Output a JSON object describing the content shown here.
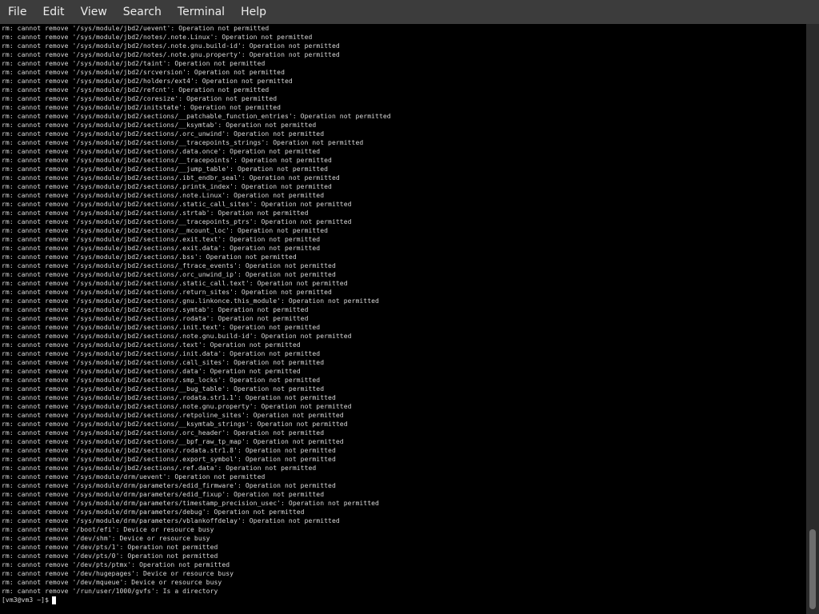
{
  "menubar": {
    "items": [
      "File",
      "Edit",
      "View",
      "Search",
      "Terminal",
      "Help"
    ]
  },
  "terminal": {
    "lines": [
      "rm: cannot remove '/sys/module/jbd2/uevent': Operation not permitted",
      "rm: cannot remove '/sys/module/jbd2/notes/.note.Linux': Operation not permitted",
      "rm: cannot remove '/sys/module/jbd2/notes/.note.gnu.build-id': Operation not permitted",
      "rm: cannot remove '/sys/module/jbd2/notes/.note.gnu.property': Operation not permitted",
      "rm: cannot remove '/sys/module/jbd2/taint': Operation not permitted",
      "rm: cannot remove '/sys/module/jbd2/srcversion': Operation not permitted",
      "rm: cannot remove '/sys/module/jbd2/holders/ext4': Operation not permitted",
      "rm: cannot remove '/sys/module/jbd2/refcnt': Operation not permitted",
      "rm: cannot remove '/sys/module/jbd2/coresize': Operation not permitted",
      "rm: cannot remove '/sys/module/jbd2/initstate': Operation not permitted",
      "rm: cannot remove '/sys/module/jbd2/sections/__patchable_function_entries': Operation not permitted",
      "rm: cannot remove '/sys/module/jbd2/sections/__ksymtab': Operation not permitted",
      "rm: cannot remove '/sys/module/jbd2/sections/.orc_unwind': Operation not permitted",
      "rm: cannot remove '/sys/module/jbd2/sections/__tracepoints_strings': Operation not permitted",
      "rm: cannot remove '/sys/module/jbd2/sections/.data.once': Operation not permitted",
      "rm: cannot remove '/sys/module/jbd2/sections/__tracepoints': Operation not permitted",
      "rm: cannot remove '/sys/module/jbd2/sections/__jump_table': Operation not permitted",
      "rm: cannot remove '/sys/module/jbd2/sections/.ibt_endbr_seal': Operation not permitted",
      "rm: cannot remove '/sys/module/jbd2/sections/.printk_index': Operation not permitted",
      "rm: cannot remove '/sys/module/jbd2/sections/.note.Linux': Operation not permitted",
      "rm: cannot remove '/sys/module/jbd2/sections/.static_call_sites': Operation not permitted",
      "rm: cannot remove '/sys/module/jbd2/sections/.strtab': Operation not permitted",
      "rm: cannot remove '/sys/module/jbd2/sections/__tracepoints_ptrs': Operation not permitted",
      "rm: cannot remove '/sys/module/jbd2/sections/__mcount_loc': Operation not permitted",
      "rm: cannot remove '/sys/module/jbd2/sections/.exit.text': Operation not permitted",
      "rm: cannot remove '/sys/module/jbd2/sections/.exit.data': Operation not permitted",
      "rm: cannot remove '/sys/module/jbd2/sections/.bss': Operation not permitted",
      "rm: cannot remove '/sys/module/jbd2/sections/_ftrace_events': Operation not permitted",
      "rm: cannot remove '/sys/module/jbd2/sections/.orc_unwind_ip': Operation not permitted",
      "rm: cannot remove '/sys/module/jbd2/sections/.static_call.text': Operation not permitted",
      "rm: cannot remove '/sys/module/jbd2/sections/.return_sites': Operation not permitted",
      "rm: cannot remove '/sys/module/jbd2/sections/.gnu.linkonce.this_module': Operation not permitted",
      "rm: cannot remove '/sys/module/jbd2/sections/.symtab': Operation not permitted",
      "rm: cannot remove '/sys/module/jbd2/sections/.rodata': Operation not permitted",
      "rm: cannot remove '/sys/module/jbd2/sections/.init.text': Operation not permitted",
      "rm: cannot remove '/sys/module/jbd2/sections/.note.gnu.build-id': Operation not permitted",
      "rm: cannot remove '/sys/module/jbd2/sections/.text': Operation not permitted",
      "rm: cannot remove '/sys/module/jbd2/sections/.init.data': Operation not permitted",
      "rm: cannot remove '/sys/module/jbd2/sections/.call_sites': Operation not permitted",
      "rm: cannot remove '/sys/module/jbd2/sections/.data': Operation not permitted",
      "rm: cannot remove '/sys/module/jbd2/sections/.smp_locks': Operation not permitted",
      "rm: cannot remove '/sys/module/jbd2/sections/__bug_table': Operation not permitted",
      "rm: cannot remove '/sys/module/jbd2/sections/.rodata.str1.1': Operation not permitted",
      "rm: cannot remove '/sys/module/jbd2/sections/.note.gnu.property': Operation not permitted",
      "rm: cannot remove '/sys/module/jbd2/sections/.retpoline_sites': Operation not permitted",
      "rm: cannot remove '/sys/module/jbd2/sections/__ksymtab_strings': Operation not permitted",
      "rm: cannot remove '/sys/module/jbd2/sections/.orc_header': Operation not permitted",
      "rm: cannot remove '/sys/module/jbd2/sections/__bpf_raw_tp_map': Operation not permitted",
      "rm: cannot remove '/sys/module/jbd2/sections/.rodata.str1.8': Operation not permitted",
      "rm: cannot remove '/sys/module/jbd2/sections/.export_symbol': Operation not permitted",
      "rm: cannot remove '/sys/module/jbd2/sections/.ref.data': Operation not permitted",
      "rm: cannot remove '/sys/module/drm/uevent': Operation not permitted",
      "rm: cannot remove '/sys/module/drm/parameters/edid_firmware': Operation not permitted",
      "rm: cannot remove '/sys/module/drm/parameters/edid_fixup': Operation not permitted",
      "rm: cannot remove '/sys/module/drm/parameters/timestamp_precision_usec': Operation not permitted",
      "rm: cannot remove '/sys/module/drm/parameters/debug': Operation not permitted",
      "rm: cannot remove '/sys/module/drm/parameters/vblankoffdelay': Operation not permitted",
      "rm: cannot remove '/boot/efi': Device or resource busy",
      "rm: cannot remove '/dev/shm': Device or resource busy",
      "rm: cannot remove '/dev/pts/1': Operation not permitted",
      "rm: cannot remove '/dev/pts/0': Operation not permitted",
      "rm: cannot remove '/dev/pts/ptmx': Operation not permitted",
      "rm: cannot remove '/dev/hugepages': Device or resource busy",
      "rm: cannot remove '/dev/mqueue': Device or resource busy",
      "rm: cannot remove '/run/user/1000/gvfs': Is a directory"
    ],
    "prompt": "[vm3@vm3 ~]$"
  }
}
